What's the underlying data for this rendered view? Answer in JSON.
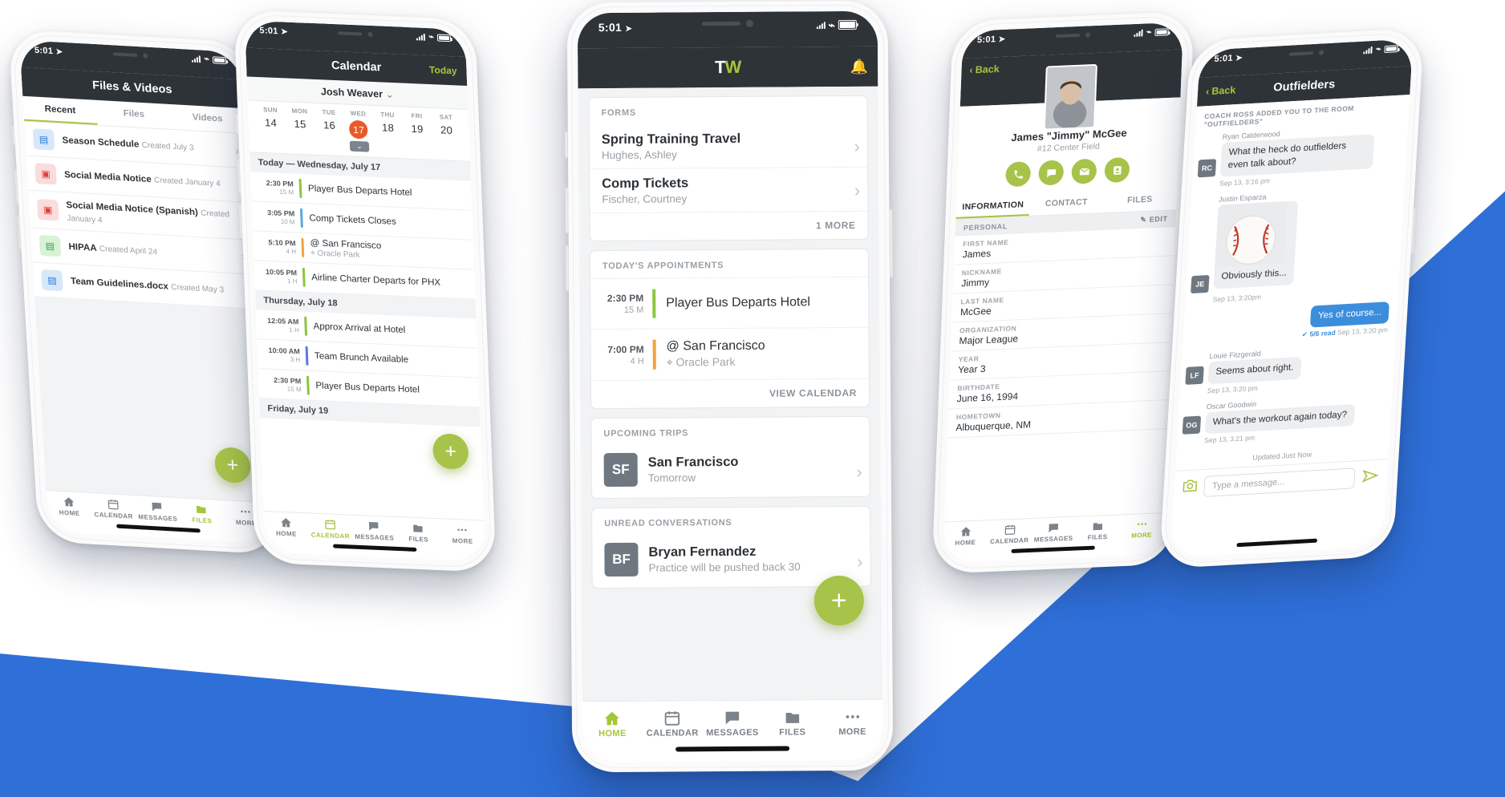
{
  "brand": {
    "accent_green": "#a4c639",
    "dark": "#2e3338",
    "blue_bg": "#2f6fd8",
    "logo_t": "T",
    "logo_w": "W"
  },
  "status_bar": {
    "time": "5:01"
  },
  "tabs": [
    {
      "label": "HOME",
      "icon": "home-icon"
    },
    {
      "label": "CALENDAR",
      "icon": "calendar-icon"
    },
    {
      "label": "MESSAGES",
      "icon": "message-icon"
    },
    {
      "label": "FILES",
      "icon": "folder-icon"
    },
    {
      "label": "MORE",
      "icon": "more-dots-icon"
    }
  ],
  "files_phone": {
    "title": "Files & Videos",
    "segments": [
      {
        "label": "Recent",
        "active": true
      },
      {
        "label": "Files",
        "active": false
      },
      {
        "label": "Videos",
        "active": false
      }
    ],
    "rows": [
      {
        "name": "Season Schedule",
        "sub": "Created July 3",
        "kind": "doc"
      },
      {
        "name": "Social Media Notice",
        "sub": "Created January 4",
        "kind": "vid"
      },
      {
        "name": "Social Media Notice (Spanish)",
        "sub": "Created January 4",
        "kind": "vid"
      },
      {
        "name": "HIPAA",
        "sub": "Created April 24",
        "kind": "frm"
      },
      {
        "name": "Team Guidelines.docx",
        "sub": "Created May 3",
        "kind": "doc"
      }
    ],
    "fab": "+",
    "active_tab": "FILES"
  },
  "calendar_phone": {
    "title": "Calendar",
    "today_action": "Today",
    "person": "Josh Weaver",
    "weekdays": [
      "SUN",
      "MON",
      "TUE",
      "WED",
      "THU",
      "FRI",
      "SAT"
    ],
    "dates": [
      "14",
      "15",
      "16",
      "17",
      "18",
      "19",
      "20"
    ],
    "selected_date": "17",
    "groups": [
      {
        "header": "Today — Wednesday, July 17",
        "events": [
          {
            "time": "2:30 PM",
            "dur": "15 M",
            "title": "Player Bus Departs Hotel",
            "sub": "",
            "color": "#8cc63f"
          },
          {
            "time": "3:05 PM",
            "dur": "10 M",
            "title": "Comp Tickets Closes",
            "sub": "",
            "color": "#5aa8e0"
          },
          {
            "time": "5:10 PM",
            "dur": "4 H",
            "title": "@ San Francisco",
            "sub": "Oracle Park",
            "color": "#f0a33c"
          },
          {
            "time": "10:05 PM",
            "dur": "1 H",
            "title": "Airline Charter Departs for PHX",
            "sub": "",
            "color": "#8cc63f"
          }
        ]
      },
      {
        "header": "Thursday, July 18",
        "events": [
          {
            "time": "12:05 AM",
            "dur": "1 H",
            "title": "Approx Arrival at Hotel",
            "sub": "",
            "color": "#8cc63f"
          },
          {
            "time": "10:00 AM",
            "dur": "3 H",
            "title": "Team Brunch Available",
            "sub": "",
            "color": "#5a78e0"
          },
          {
            "time": "2:30 PM",
            "dur": "15 M",
            "title": "Player Bus Departs Hotel",
            "sub": "",
            "color": "#8cc63f"
          }
        ]
      },
      {
        "header": "Friday, July 19",
        "events": []
      }
    ],
    "fab": "+",
    "active_tab": "CALENDAR"
  },
  "home_phone": {
    "forms": {
      "header": "FORMS",
      "rows": [
        {
          "title": "Spring Training Travel",
          "sub": "Hughes, Ashley"
        },
        {
          "title": "Comp Tickets",
          "sub": "Fischer, Courtney"
        }
      ],
      "footer": "1 MORE"
    },
    "appointments": {
      "header": "TODAY'S APPOINTMENTS",
      "rows": [
        {
          "time": "2:30 PM",
          "dur": "15 M",
          "title": "Player Bus Departs Hotel",
          "loc": "",
          "color": "#8cc63f"
        },
        {
          "time": "7:00 PM",
          "dur": "4 H",
          "title": "@ San Francisco",
          "loc": "Oracle Park",
          "color": "#f0a33c"
        }
      ],
      "footer": "VIEW CALENDAR"
    },
    "trips": {
      "header": "UPCOMING TRIPS",
      "rows": [
        {
          "initials": "SF",
          "title": "San Francisco",
          "sub": "Tomorrow"
        }
      ]
    },
    "conversations": {
      "header": "UNREAD CONVERSATIONS",
      "rows": [
        {
          "initials": "BF",
          "title": "Bryan Fernandez",
          "sub": "Practice will be pushed back 30"
        }
      ]
    },
    "fab": "+",
    "active_tab": "HOME"
  },
  "profile_phone": {
    "back": "Back",
    "name": "James \"Jimmy\" McGee",
    "position": "#12 Center Field",
    "actions": [
      "phone-icon",
      "message-icon",
      "email-icon",
      "contact-card-icon"
    ],
    "tabs": [
      {
        "label": "INFORMATION",
        "active": true
      },
      {
        "label": "CONTACT",
        "active": false
      },
      {
        "label": "FILES",
        "active": false
      }
    ],
    "section": "PERSONAL",
    "edit": "EDIT",
    "fields": [
      {
        "key": "FIRST NAME",
        "value": "James"
      },
      {
        "key": "NICKNAME",
        "value": "Jimmy"
      },
      {
        "key": "LAST NAME",
        "value": "McGee"
      },
      {
        "key": "ORGANIZATION",
        "value": "Major League"
      },
      {
        "key": "YEAR",
        "value": "Year 3"
      },
      {
        "key": "BIRTHDATE",
        "value": "June 16, 1994"
      },
      {
        "key": "HOMETOWN",
        "value": "Albuquerque, NM"
      }
    ],
    "active_tab": "FILES"
  },
  "chat_phone": {
    "back": "Back",
    "title": "Outfielders",
    "system_message": "COACH ROSS ADDED YOU TO THE ROOM \"OUTFIELDERS\"",
    "messages": [
      {
        "who": "Ryan Calderwood",
        "initials": "RC",
        "text": "What the heck do outfielders even talk about?",
        "ts": "Sep 13, 3:16 pm",
        "mine": false,
        "image": false
      },
      {
        "who": "Justin Esparza",
        "initials": "JE",
        "text": "Obviously this...",
        "ts": "Sep 13, 3:20pm",
        "mine": false,
        "image": true
      },
      {
        "who": "",
        "initials": "",
        "text": "Yes of course...",
        "ts": "Sep 13, 3:20 pm",
        "mine": true,
        "read": "5/6 read",
        "image": false
      },
      {
        "who": "Louie Fitzgerald",
        "initials": "LF",
        "text": "Seems about right.",
        "ts": "Sep 13, 3:20 pm",
        "mine": false,
        "image": false
      },
      {
        "who": "Oscar Goodwin",
        "initials": "OG",
        "text": "What's the workout again today?",
        "ts": "Sep 13, 3:21 pm",
        "mine": false,
        "image": false
      }
    ],
    "updated": "Updated Just Now",
    "composer_placeholder": "Type a message...",
    "camera_icon": "camera-icon",
    "send_icon": "send-icon",
    "active_tab": "MORE"
  }
}
